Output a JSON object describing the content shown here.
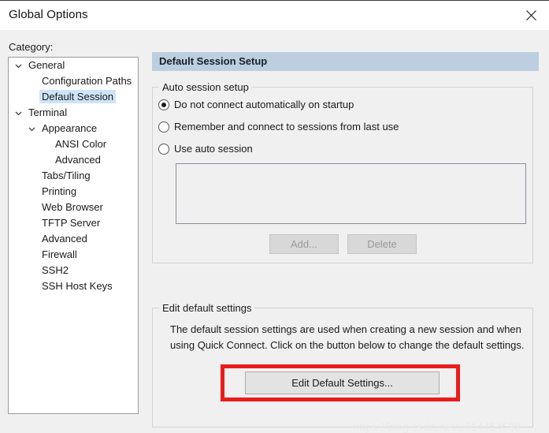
{
  "window": {
    "title": "Global Options",
    "close_icon": "close-icon"
  },
  "sidebar": {
    "label": "Category:",
    "items": [
      {
        "label": "General",
        "level": 0,
        "expander": "chevron-down-icon",
        "selected": false
      },
      {
        "label": "Configuration Paths",
        "level": 1,
        "expander": "none",
        "selected": false
      },
      {
        "label": "Default Session",
        "level": 1,
        "expander": "none",
        "selected": true
      },
      {
        "label": "Terminal",
        "level": 0,
        "expander": "chevron-down-icon",
        "selected": false
      },
      {
        "label": "Appearance",
        "level": 1,
        "expander": "chevron-down-icon",
        "selected": false
      },
      {
        "label": "ANSI Color",
        "level": 2,
        "expander": "none",
        "selected": false
      },
      {
        "label": "Advanced",
        "level": 2,
        "expander": "none",
        "selected": false
      },
      {
        "label": "Tabs/Tiling",
        "level": 1,
        "expander": "none",
        "selected": false
      },
      {
        "label": "Printing",
        "level": 1,
        "expander": "none",
        "selected": false
      },
      {
        "label": "Web Browser",
        "level": 1,
        "expander": "none",
        "selected": false
      },
      {
        "label": "TFTP Server",
        "level": 1,
        "expander": "none",
        "selected": false
      },
      {
        "label": "Advanced",
        "level": 1,
        "expander": "none",
        "selected": false
      },
      {
        "label": "Firewall",
        "level": 1,
        "expander": "none",
        "selected": false
      },
      {
        "label": "SSH2",
        "level": 1,
        "expander": "none",
        "selected": false
      },
      {
        "label": "SSH Host Keys",
        "level": 1,
        "expander": "none",
        "selected": false
      }
    ]
  },
  "main": {
    "header": "Default Session Setup",
    "auto_session": {
      "legend": "Auto session setup",
      "options": [
        {
          "label": "Do not connect automatically on startup",
          "checked": true
        },
        {
          "label": "Remember and connect to sessions from last use",
          "checked": false
        },
        {
          "label": "Use auto session",
          "checked": false
        }
      ],
      "listbox_items": [],
      "add_button": "Add...",
      "delete_button": "Delete"
    },
    "edit_default": {
      "legend": "Edit default settings",
      "description": "The default session settings are used when creating a new session and when using Quick Connect.  Click on the button below to change the default settings.",
      "button": "Edit Default Settings..."
    }
  },
  "annotation": {
    "highlight_color": "#eb1c1c"
  },
  "watermark": {
    "text": "https://blog.csdn.net/u014454538"
  }
}
